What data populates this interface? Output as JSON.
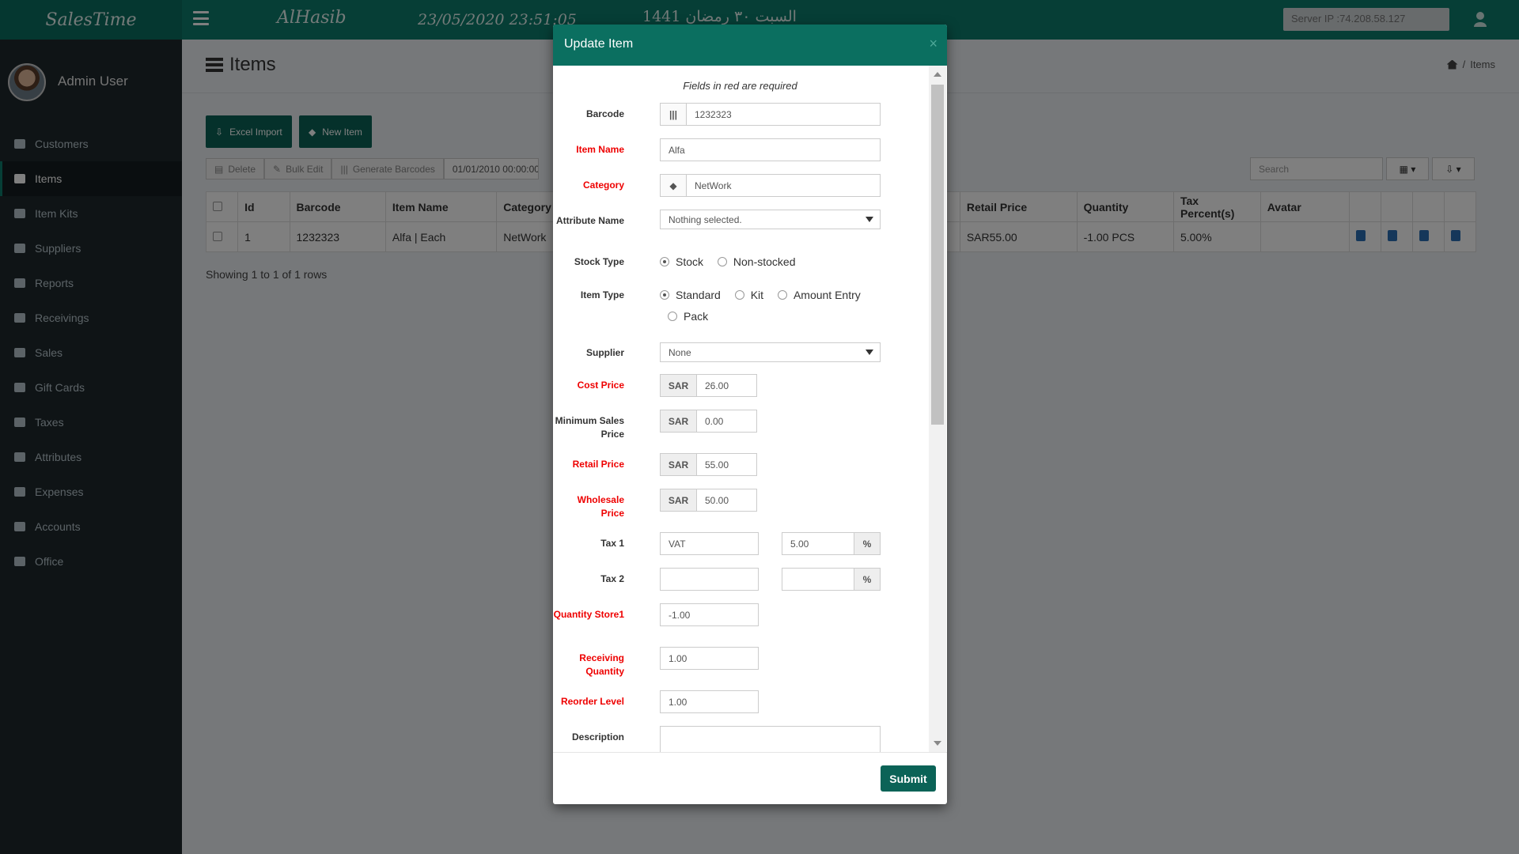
{
  "header": {
    "brand": "SalesTime",
    "app_name": "AlHasib",
    "datetime": "23/05/2020 23:51:05",
    "hijri": "السبت ٣٠ رمضان 1441",
    "server_ip": "Server IP :74.208.58.127"
  },
  "sidebar": {
    "user_name": "Admin User",
    "items": [
      {
        "label": "Customers",
        "icon": "users-icon"
      },
      {
        "label": "Items",
        "icon": "list-icon"
      },
      {
        "label": "Item Kits",
        "icon": "cube-icon"
      },
      {
        "label": "Suppliers",
        "icon": "book-icon"
      },
      {
        "label": "Reports",
        "icon": "chart-icon"
      },
      {
        "label": "Receivings",
        "icon": "truck-icon"
      },
      {
        "label": "Sales",
        "icon": "cart-icon"
      },
      {
        "label": "Gift Cards",
        "icon": "gift-icon"
      },
      {
        "label": "Taxes",
        "icon": "money-icon"
      },
      {
        "label": "Attributes",
        "icon": "star-icon"
      },
      {
        "label": "Expenses",
        "icon": "card-icon"
      },
      {
        "label": "Accounts",
        "icon": "calculator-icon"
      },
      {
        "label": "Office",
        "icon": "gear-icon"
      }
    ],
    "active": "Items"
  },
  "page": {
    "title": "Items",
    "breadcrumb": "Items",
    "excel_import": "Excel Import",
    "new_item": "New Item",
    "delete": "Delete",
    "bulk_edit": "Bulk Edit",
    "generate_barcodes": "Generate Barcodes",
    "date_range": "01/01/2010 00:00:00",
    "search_placeholder": "Search",
    "showing": "Showing 1 to 1 of 1 rows"
  },
  "table": {
    "columns": [
      "Id",
      "Barcode",
      "Item Name",
      "Category",
      "Retail Price",
      "Quantity",
      "Tax Percent(s)",
      "Avatar"
    ],
    "rows": [
      {
        "id": "1",
        "barcode": "1232323",
        "item_name": "Alfa | Each",
        "category": "NetWork",
        "retail_price": "SAR55.00",
        "quantity": "-1.00 PCS",
        "tax": "5.00%"
      }
    ]
  },
  "modal": {
    "title": "Update Item",
    "close": "×",
    "required_note": "Fields in red are required",
    "barcode_label": "Barcode",
    "barcode_value": "1232323",
    "item_name_label": "Item Name",
    "item_name_value": "Alfa",
    "category_label": "Category",
    "category_value": "NetWork",
    "attribute_label": "Attribute Name",
    "attribute_value": "Nothing selected.",
    "stock_type_label": "Stock Type",
    "stock_options": [
      "Stock",
      "Non-stocked"
    ],
    "item_type_label": "Item Type",
    "item_type_options": [
      "Standard",
      "Kit",
      "Amount Entry",
      "Pack"
    ],
    "supplier_label": "Supplier",
    "supplier_value": "None",
    "currency": "SAR",
    "cost_price_label": "Cost Price",
    "cost_price_value": "26.00",
    "min_sales_label": "Minimum Sales Price",
    "min_sales_value": "0.00",
    "retail_price_label": "Retail Price",
    "retail_price_value": "55.00",
    "wholesale_label": "Wholesale Price",
    "wholesale_value": "50.00",
    "tax1_label": "Tax 1",
    "tax1_name": "VAT",
    "tax1_pct": "5.00",
    "tax2_label": "Tax 2",
    "pct_symbol": "%",
    "qty_store_label": "Quantity Store1",
    "qty_store_value": "-1.00",
    "receiving_qty_label": "Receiving Quantity",
    "receiving_qty_value": "1.00",
    "reorder_label": "Reorder Level",
    "reorder_value": "1.00",
    "description_label": "Description",
    "submit": "Submit"
  }
}
